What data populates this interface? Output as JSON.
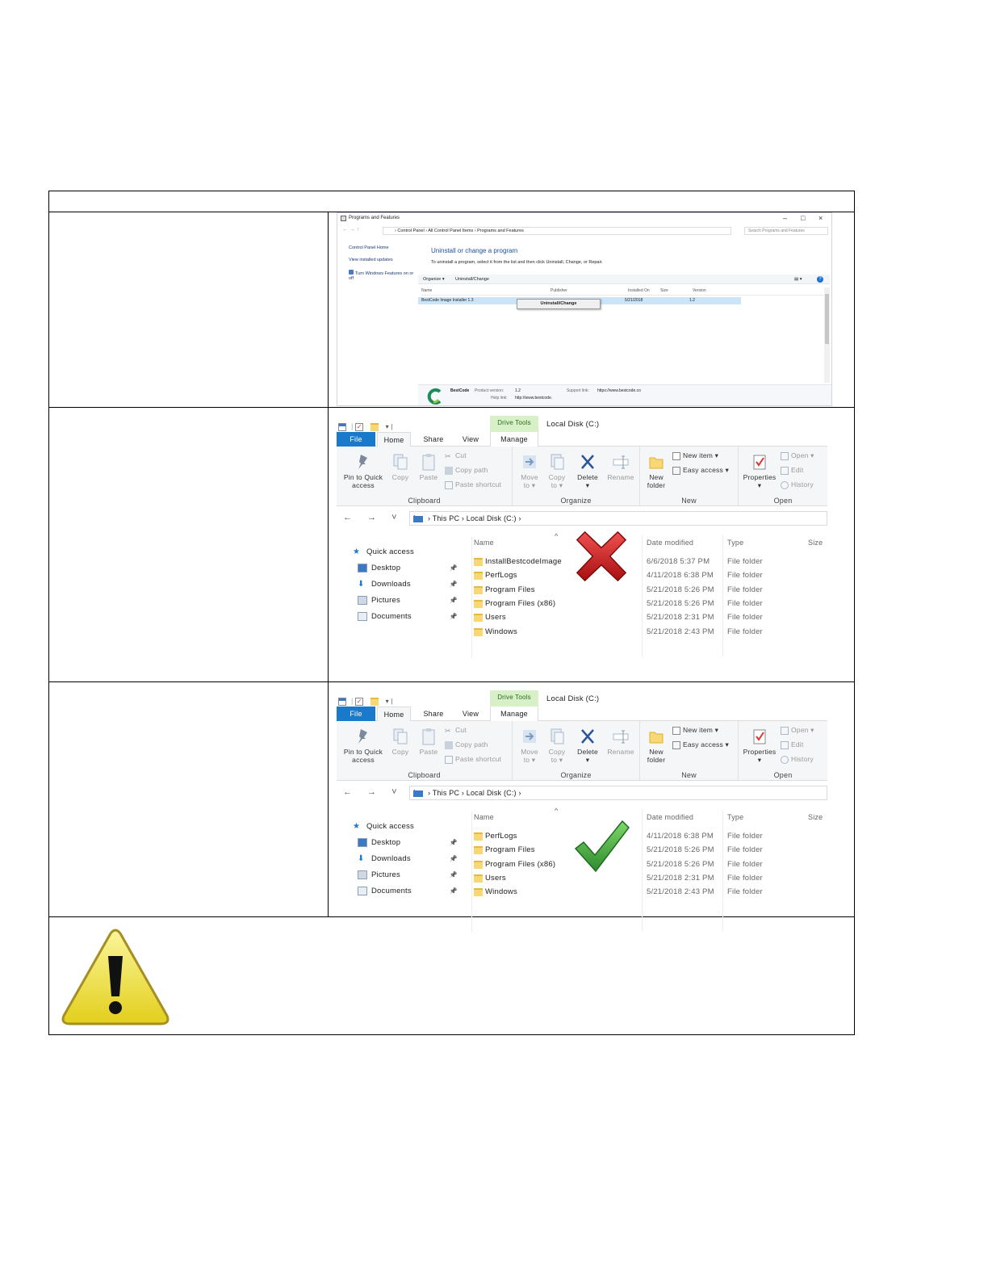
{
  "programs": {
    "window_title": "Programs and Features",
    "nav_arrows": "←  →   ↑",
    "breadcrumb": "›  Control Panel  ›  All Control Panel Items  ›  Programs and Features",
    "search_placeholder": "Search Programs and Features",
    "sidebar": [
      "Control Panel Home",
      "View installed updates",
      "Turn Windows Features on or off"
    ],
    "heading": "Uninstall or change a program",
    "subheading": "To uninstall a program, select it from the list and then click Uninstall, Change, or Repair.",
    "toolbar": {
      "organize": "Organize ▾",
      "uninstall": "Uninstall/Change",
      "views": "▤ ▾",
      "help": "?"
    },
    "columns": {
      "name": "Name",
      "publisher": "Publisher",
      "installed_on": "Installed On",
      "size": "Size",
      "version": "Version"
    },
    "row": {
      "name": "BestCode Image Installer 1.3",
      "installed_on": "5/21/2018",
      "version": "1.2"
    },
    "context_menu": "Uninstall/Change",
    "details": {
      "company": "BestCode",
      "product_version_label": "Product version:",
      "product_version": "1.2",
      "support_label": "Support link:",
      "support_link": "https://www.bestcode.co",
      "help_label": "Help link:",
      "help_link": "http://www.bestcode."
    },
    "brand_color": "#1f8a5a"
  },
  "explorer": {
    "drive_tools": "Drive Tools",
    "window_title": "Local Disk (C:)",
    "tabs": [
      "File",
      "Home",
      "Share",
      "View",
      "Manage"
    ],
    "clipboard": {
      "pin_line1": "Pin to Quick",
      "pin_line2": "access",
      "copy": "Copy",
      "paste": "Paste",
      "cut": "Cut",
      "copy_path": "Copy path",
      "paste_shortcut": "Paste shortcut",
      "label": "Clipboard"
    },
    "organize": {
      "move_line1": "Move",
      "move_line2": "to ▾",
      "copy_line1": "Copy",
      "copy_line2": "to ▾",
      "delete": "Delete",
      "delete_arrow": "▾",
      "rename": "Rename",
      "label": "Organize"
    },
    "new": {
      "new_folder_line1": "New",
      "new_folder_line2": "folder",
      "new_item": "New item ▾",
      "easy_access": "Easy access ▾",
      "label": "New"
    },
    "open": {
      "properties": "Properties",
      "properties_arrow": "▾",
      "open": "Open ▾",
      "edit": "Edit",
      "history": "History",
      "label": "Open"
    },
    "nav_arrows": "← → ˅ ↑",
    "path": "›  This PC  ›  Local Disk (C:)  ›",
    "quick_access": [
      {
        "label": "Quick access",
        "pin": ""
      },
      {
        "label": "Desktop",
        "pin": "📌"
      },
      {
        "label": "Downloads",
        "pin": "📌"
      },
      {
        "label": "Pictures",
        "pin": "📌"
      },
      {
        "label": "Documents",
        "pin": "📌"
      }
    ],
    "columns": {
      "name": "Name",
      "date_modified": "Date modified",
      "type": "Type",
      "size": "Size",
      "sort": "^"
    }
  },
  "before_files": [
    {
      "name": "InstallBestcodeImage",
      "date": "6/6/2018 5:37 PM",
      "type": "File folder"
    },
    {
      "name": "PerfLogs",
      "date": "4/11/2018 6:38 PM",
      "type": "File folder"
    },
    {
      "name": "Program Files",
      "date": "5/21/2018 5:26 PM",
      "type": "File folder"
    },
    {
      "name": "Program Files (x86)",
      "date": "5/21/2018 5:26 PM",
      "type": "File folder"
    },
    {
      "name": "Users",
      "date": "5/21/2018 2:31 PM",
      "type": "File folder"
    },
    {
      "name": "Windows",
      "date": "5/21/2018 2:43 PM",
      "type": "File folder"
    }
  ],
  "after_files": [
    {
      "name": "PerfLogs",
      "date": "4/11/2018 6:38 PM",
      "type": "File folder"
    },
    {
      "name": "Program Files",
      "date": "5/21/2018 5:26 PM",
      "type": "File folder"
    },
    {
      "name": "Program Files (x86)",
      "date": "5/21/2018 5:26 PM",
      "type": "File folder"
    },
    {
      "name": "Users",
      "date": "5/21/2018 2:31 PM",
      "type": "File folder"
    },
    {
      "name": "Windows",
      "date": "5/21/2018 2:43 PM",
      "type": "File folder"
    }
  ],
  "icons": {
    "red_x": "cross-mark-icon",
    "green_check": "check-mark-icon",
    "warning": "warning-triangle-icon"
  },
  "colors": {
    "file_tab": "#1979ca",
    "drive_tools_bg": "#d7f0c8",
    "selected_row": "#cce4f7",
    "folder": "#f8d775",
    "red_x": "#d01f1f",
    "green_check": "#3aa63a",
    "warning_yellow": "#f2e23a"
  }
}
